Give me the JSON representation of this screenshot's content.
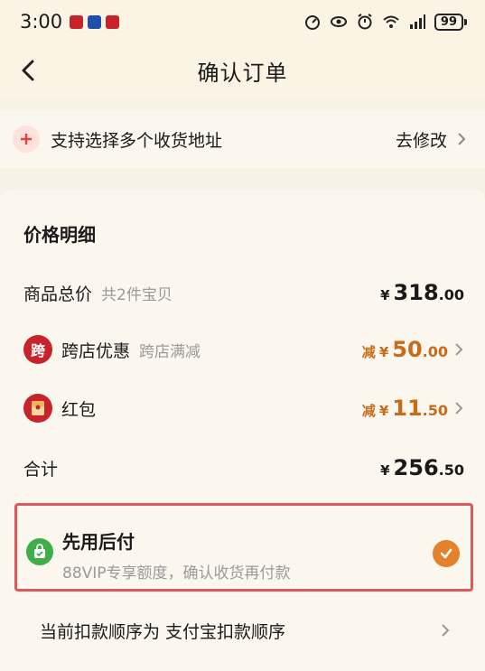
{
  "status_bar": {
    "time": "3:00",
    "battery": "99",
    "icons": [
      "app-notification-icon",
      "app-notification-icon",
      "app-notification-icon",
      "speed-icon",
      "eye-icon",
      "alarm-icon",
      "wifi-icon",
      "signal-icon",
      "battery-icon"
    ]
  },
  "header": {
    "title": "确认订单",
    "back_icon": "chevron-left-icon"
  },
  "address": {
    "text": "支持选择多个收货地址",
    "action": "去修改",
    "icon": "plus-icon"
  },
  "price_detail": {
    "title": "价格明细",
    "items": [
      {
        "label": "商品总价",
        "sub": "共2件宝贝",
        "prefix": "",
        "yen": "¥",
        "int": "318",
        "dec": ".00"
      },
      {
        "label": "跨店优惠",
        "sub": "跨店满减",
        "prefix": "减",
        "yen": "¥",
        "int": "50",
        "dec": ".00",
        "icon_char": "跨"
      },
      {
        "label": "红包",
        "sub": "",
        "prefix": "减",
        "yen": "¥",
        "int": "11",
        "dec": ".50"
      },
      {
        "label": "合计",
        "sub": "",
        "prefix": "",
        "yen": "¥",
        "int": "256",
        "dec": ".50"
      }
    ]
  },
  "pay_later": {
    "title": "先用后付",
    "subtitle": "88VIP专享额度，确认收货再付款",
    "checked": true
  },
  "payment_order": {
    "text": "当前扣款顺序为 支付宝扣款顺序"
  },
  "colors": {
    "accent": "#c86b1a",
    "highlight_border": "#e0565b",
    "check": "#e2822d",
    "green": "#3fae49",
    "red_badge": "#c8222b"
  }
}
